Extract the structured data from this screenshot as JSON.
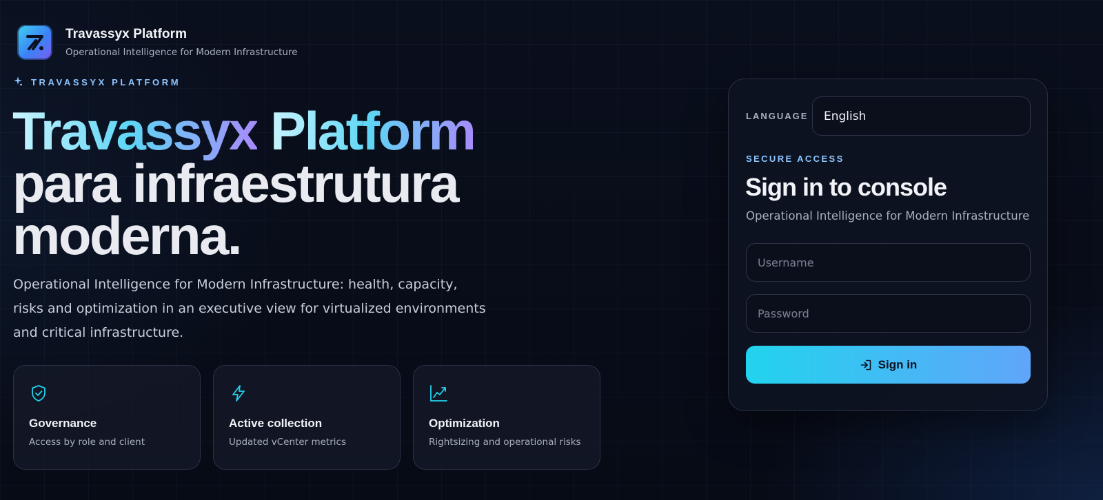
{
  "brand": {
    "title": "Travassyx Platform",
    "subtitle": "Operational Intelligence for Modern Infrastructure",
    "logo_icon": "logo-mark-icon"
  },
  "hero": {
    "eyebrow": "TRAVASSYX PLATFORM",
    "eyebrow_icon": "sparkle-icon",
    "title_highlight_1": "Travassyx",
    "title_highlight_2": "Platform",
    "title_rest_line_1": "para infraestrutura",
    "title_rest_line_2": "moderna.",
    "description": "Operational Intelligence for Modern Infrastructure: health, capacity, risks and optimization in an executive view for virtualized environments and critical infrastructure."
  },
  "features": [
    {
      "icon": "shield-check-icon",
      "title": "Governance",
      "description": "Access by role and client"
    },
    {
      "icon": "lightning-icon",
      "title": "Active collection",
      "description": "Updated vCenter metrics"
    },
    {
      "icon": "trend-chart-icon",
      "title": "Optimization",
      "description": "Rightsizing and operational risks"
    }
  ],
  "login": {
    "language_label": "LANGUAGE",
    "language_value": "English",
    "secure_label": "SECURE ACCESS",
    "title": "Sign in to console",
    "subtitle": "Operational Intelligence for Modern Infrastructure",
    "username_placeholder": "Username",
    "username_value": "",
    "password_placeholder": "Password",
    "password_value": "",
    "signin_label": "Sign in",
    "signin_icon": "login-arrow-icon"
  },
  "colors": {
    "accent_cyan": "#22d3ee",
    "accent_blue": "#60a5fa",
    "accent_violet": "#a78bfa",
    "background": "#070b18"
  }
}
